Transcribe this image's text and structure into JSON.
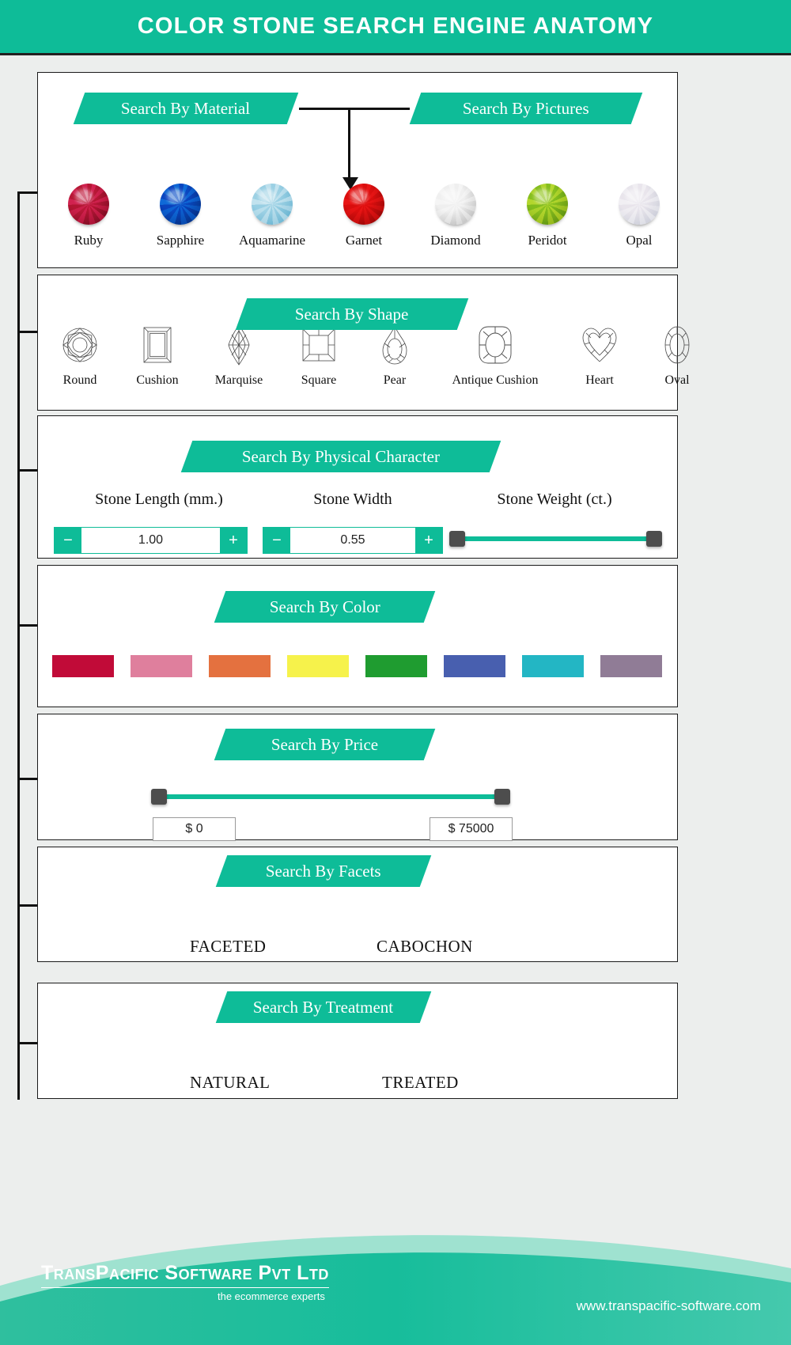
{
  "header": {
    "title": "COLOR STONE SEARCH ENGINE ANATOMY",
    "accent": "#0ebc98"
  },
  "sections": {
    "material": {
      "banner": "Search By Material"
    },
    "pictures": {
      "banner": "Search By Pictures"
    },
    "shape": {
      "banner": "Search By Shape"
    },
    "physical": {
      "banner": "Search By Physical Character"
    },
    "color": {
      "banner": "Search By Color"
    },
    "price": {
      "banner": "Search By Price"
    },
    "facets": {
      "banner": "Search By Facets"
    },
    "treatment": {
      "banner": "Search By Treatment"
    }
  },
  "stones": [
    {
      "name": "Ruby",
      "color": "#c01a3e",
      "color2": "#7c0a22"
    },
    {
      "name": "Sapphire",
      "color": "#0b52c8",
      "color2": "#03307e"
    },
    {
      "name": "Aquamarine",
      "color": "#a9d7e8",
      "color2": "#6fb6d2"
    },
    {
      "name": "Garnet",
      "color": "#e01010",
      "color2": "#8e0606"
    },
    {
      "name": "Diamond",
      "color": "#f2f2f2",
      "color2": "#b9b9b9"
    },
    {
      "name": "Peridot",
      "color": "#96c723",
      "color2": "#6b9310"
    },
    {
      "name": "Opal",
      "color": "#ece9ef",
      "color2": "#c9cdd8"
    }
  ],
  "shapes": [
    {
      "name": "Round",
      "icon": "round-shape-icon"
    },
    {
      "name": "Cushion",
      "icon": "cushion-shape-icon"
    },
    {
      "name": "Marquise",
      "icon": "marquise-shape-icon"
    },
    {
      "name": "Square",
      "icon": "square-shape-icon"
    },
    {
      "name": "Pear",
      "icon": "pear-shape-icon"
    },
    {
      "name": "Antique Cushion",
      "icon": "antique-cushion-shape-icon"
    },
    {
      "name": "Heart",
      "icon": "heart-shape-icon"
    },
    {
      "name": "Oval",
      "icon": "oval-shape-icon"
    }
  ],
  "physical": {
    "length": {
      "label": "Stone Length (mm.)",
      "value": "1.00",
      "minus": "−",
      "plus": "+"
    },
    "width": {
      "label": "Stone Width",
      "value": "0.55",
      "minus": "−",
      "plus": "+"
    },
    "weight": {
      "label": "Stone Weight (ct.)"
    }
  },
  "colors": [
    {
      "name": "crimson",
      "hex": "#c10b38"
    },
    {
      "name": "pink",
      "hex": "#df7f9d"
    },
    {
      "name": "orange",
      "hex": "#e4713f"
    },
    {
      "name": "yellow",
      "hex": "#f6f24b"
    },
    {
      "name": "green",
      "hex": "#1f9c30"
    },
    {
      "name": "blue",
      "hex": "#485faf"
    },
    {
      "name": "cyan",
      "hex": "#23b6c4"
    },
    {
      "name": "mauve",
      "hex": "#907c96"
    }
  ],
  "price": {
    "min": "$ 0",
    "max": "$ 75000"
  },
  "facets": {
    "option1": "FACETED",
    "option2": "CABOCHON"
  },
  "treatment": {
    "option1": "NATURAL",
    "option2": "TREATED"
  },
  "footer": {
    "logo": "TransPacific Software Pvt Ltd",
    "tagline": "the ecommerce experts",
    "url": "www.transpacific-software.com"
  }
}
